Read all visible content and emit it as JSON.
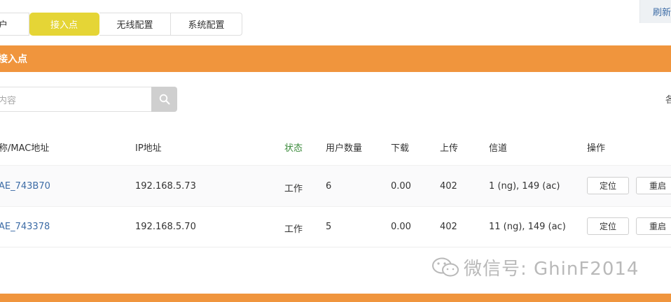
{
  "tabs": [
    {
      "label": "户"
    },
    {
      "label": "接入点"
    },
    {
      "label": "无线配置"
    },
    {
      "label": "系统配置"
    }
  ],
  "toolbar": {
    "refresh_label": "刷新"
  },
  "section": {
    "title": "接入点"
  },
  "search": {
    "placeholder": "内容"
  },
  "right_cut_text": "各",
  "table": {
    "headers": [
      "称/MAC地址",
      "IP地址",
      "状态",
      "用户数量",
      "下载",
      "上传",
      "信道",
      "操作"
    ],
    "rows": [
      {
        "name": "AE_743B70",
        "ip": "192.168.5.73",
        "status": "工作",
        "users": "6",
        "download": "0.00",
        "upload": "402",
        "channel": "1 (ng), 149 (ac)",
        "locate": "定位",
        "reboot": "重启"
      },
      {
        "name": "AE_743378",
        "ip": "192.168.5.70",
        "status": "工作",
        "users": "5",
        "download": "0.00",
        "upload": "402",
        "channel": "11 (ng), 149 (ac)",
        "locate": "定位",
        "reboot": "重启"
      }
    ]
  },
  "watermark": {
    "text": "微信号: GhinF2014"
  },
  "colors": {
    "accent_orange": "#f0953d",
    "active_tab": "#e5d536",
    "link_blue": "#3d6ca6"
  }
}
